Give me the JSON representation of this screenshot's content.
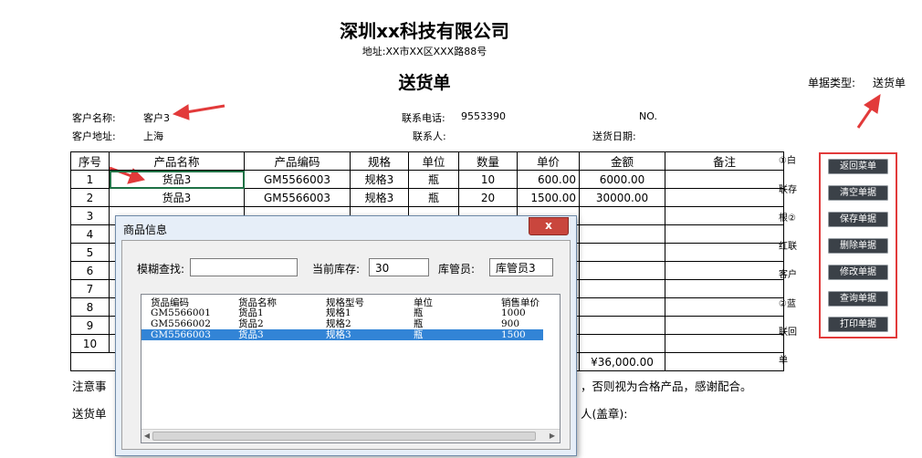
{
  "document": {
    "company": "深圳xx科技有限公司",
    "address": "地址:XX市XX区XXX路88号",
    "title": "送货单",
    "doc_type_label": "单据类型:",
    "doc_type_value": "送货单",
    "customer_name_label": "客户名称:",
    "customer_name": "客户3",
    "customer_addr_label": "客户地址:",
    "customer_addr": "上海",
    "phone_label": "联系电话:",
    "phone": "9553390",
    "contact_label": "联系人:",
    "no_label": "NO.",
    "date_label": "送货日期:"
  },
  "table": {
    "headers": [
      "序号",
      "产品名称",
      "产品编码",
      "规格",
      "单位",
      "数量",
      "单价",
      "金额",
      "备注"
    ],
    "rows": [
      [
        "1",
        "货品3",
        "GM5566003",
        "规格3",
        "瓶",
        "10",
        "600.00",
        "6000.00",
        ""
      ],
      [
        "2",
        "货品3",
        "GM5566003",
        "规格3",
        "瓶",
        "20",
        "1500.00",
        "30000.00",
        ""
      ],
      [
        "3",
        "",
        "",
        "",
        "",
        "",
        "",
        "",
        ""
      ],
      [
        "4",
        "",
        "",
        "",
        "",
        "",
        "",
        "",
        ""
      ],
      [
        "5",
        "",
        "",
        "",
        "",
        "",
        "",
        "",
        ""
      ],
      [
        "6",
        "",
        "",
        "",
        "",
        "",
        "",
        "",
        ""
      ],
      [
        "7",
        "",
        "",
        "",
        "",
        "",
        "",
        "",
        ""
      ],
      [
        "8",
        "",
        "",
        "",
        "",
        "",
        "",
        "",
        ""
      ],
      [
        "9",
        "",
        "",
        "",
        "",
        "",
        "",
        "",
        ""
      ],
      [
        "10",
        "",
        "",
        "",
        "",
        "",
        "",
        "",
        ""
      ]
    ],
    "total": "¥36,000.00"
  },
  "side_labels": [
    "①白",
    "联存",
    "根②",
    "红联",
    "客户",
    "②蓝",
    "联回",
    "单"
  ],
  "buttons": [
    "返回菜单",
    "清空单据",
    "保存单据",
    "删除单据",
    "修改单据",
    "查询单据",
    "打印单据"
  ],
  "footer": {
    "note_prefix": "注意事",
    "note_suffix": "，否则视为合格产品，感谢配合。",
    "signer_prefix": "送货单",
    "signer_suffix": "人(盖章):"
  },
  "dialog": {
    "title": "商品信息",
    "close_glyph": "x",
    "fuzzy_label": "模糊查找:",
    "fuzzy_value": "",
    "stock_label": "当前库存:",
    "stock_value": "30",
    "keeper_label": "库管员:",
    "keeper_value": "库管员3",
    "list_headers": [
      "货品编码",
      "货品名称",
      "规格型号",
      "单位",
      "销售单价"
    ],
    "list_rows": [
      [
        "GM5566001",
        "货品1",
        "规格1",
        "瓶",
        "1000"
      ],
      [
        "GM5566002",
        "货品2",
        "规格2",
        "瓶",
        "900"
      ],
      [
        "GM5566003",
        "货品3",
        "规格3",
        "瓶",
        "1500"
      ]
    ],
    "selected_index": 2
  },
  "colors": {
    "annotation_red": "#e23a3a",
    "selection_blue": "#3284d6",
    "button_dark": "#3b4148"
  }
}
